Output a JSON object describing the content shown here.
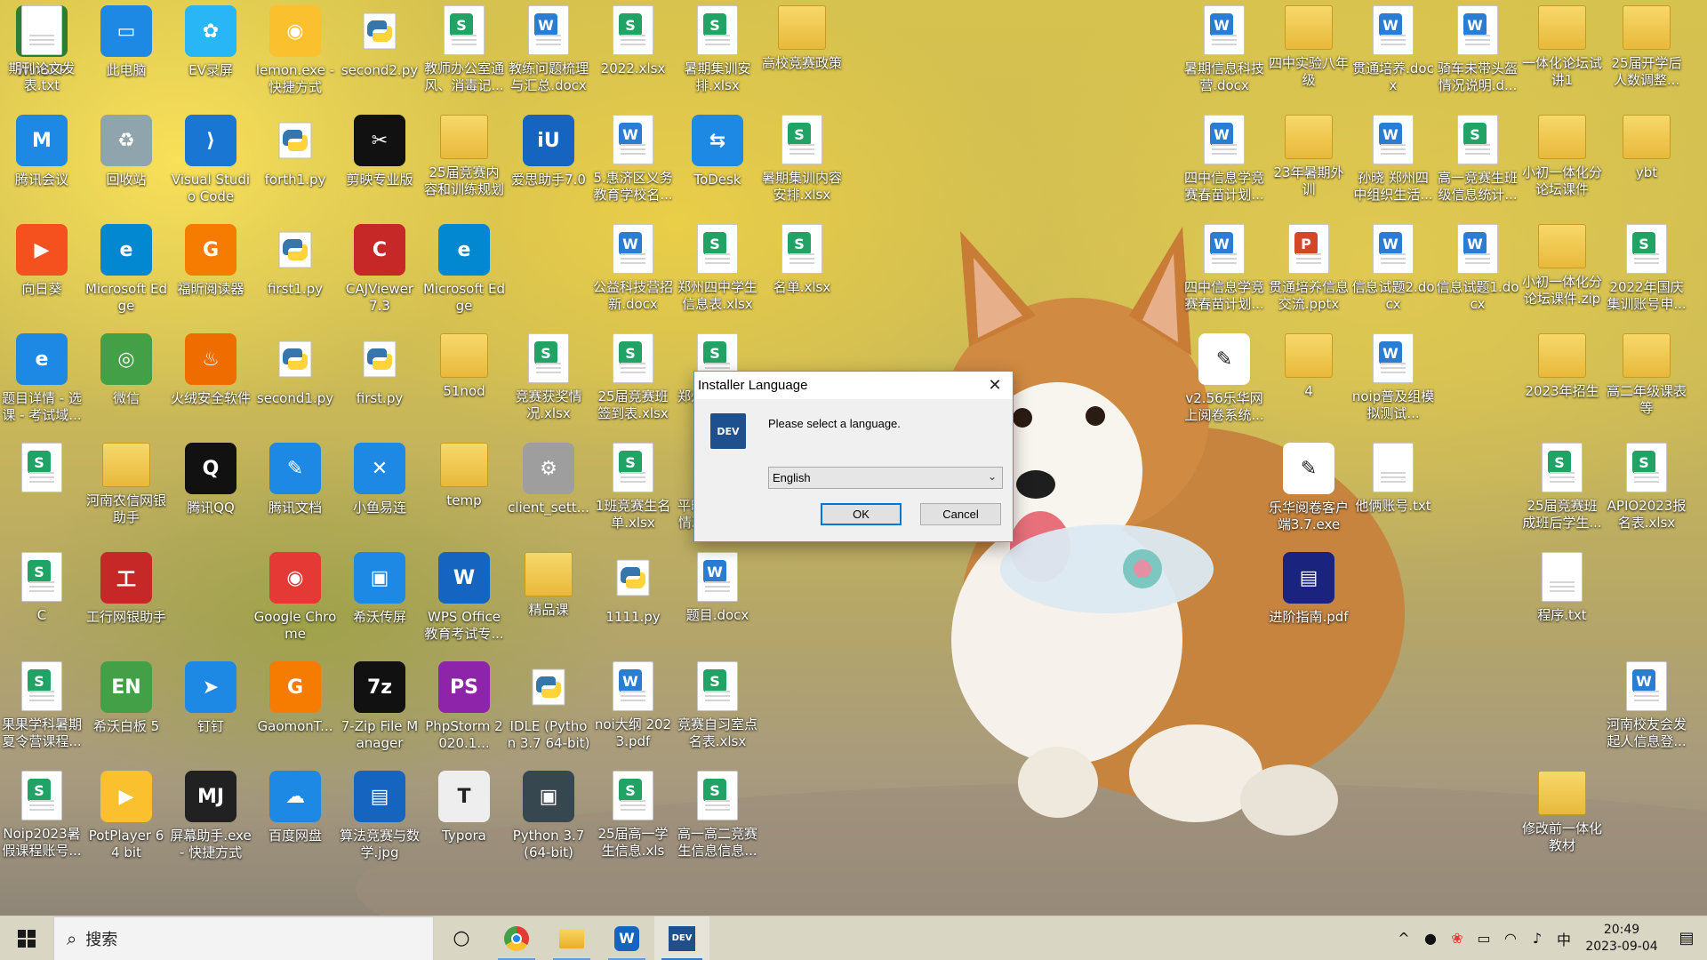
{
  "desktop_icons": [
    {
      "label": "WinSCP",
      "kind": "app",
      "color": "#2e7d32",
      "glyph": "⇄"
    },
    {
      "label": "此电脑",
      "kind": "app",
      "color": "#1e88e5",
      "glyph": "▭"
    },
    {
      "label": "EV录屏",
      "kind": "app",
      "color": "#29b6f6",
      "glyph": "✿"
    },
    {
      "label": "lemon.exe - 快捷方式",
      "kind": "app",
      "color": "#fbc02d",
      "glyph": "◉"
    },
    {
      "label": "second2.py",
      "kind": "py"
    },
    {
      "label": "教师办公室通风、消毒记...",
      "kind": "xlsx"
    },
    {
      "label": "教练问题梳理与汇总.docx",
      "kind": "docx"
    },
    {
      "label": "2022.xlsx",
      "kind": "xlsx"
    },
    {
      "label": "暑期集训安排.xlsx",
      "kind": "xlsx"
    },
    {
      "label": "高校竞赛政策",
      "kind": "folder"
    },
    {
      "label": "腾讯会议",
      "kind": "app",
      "color": "#1e88e5",
      "glyph": "M"
    },
    {
      "label": "回收站",
      "kind": "app",
      "color": "#90a4ae",
      "glyph": "♻"
    },
    {
      "label": "Visual Studio Code",
      "kind": "app",
      "color": "#1976d2",
      "glyph": "⟩"
    },
    {
      "label": "forth1.py",
      "kind": "py"
    },
    {
      "label": "剪映专业版",
      "kind": "app",
      "color": "#111111",
      "glyph": "✂"
    },
    {
      "label": "25届竞赛内容和训练规划",
      "kind": "folder"
    },
    {
      "label": "爱思助手7.0",
      "kind": "app",
      "color": "#1565c0",
      "glyph": "iU"
    },
    {
      "label": "5.惠济区义务教育学校名...",
      "kind": "docx"
    },
    {
      "label": "ToDesk",
      "kind": "app",
      "color": "#1e88e5",
      "glyph": "⇆"
    },
    {
      "label": "暑期集训内容安排.xlsx",
      "kind": "xlsx"
    },
    {
      "label": "向日葵",
      "kind": "app",
      "color": "#f4511e",
      "glyph": "▶"
    },
    {
      "label": "Microsoft Edge",
      "kind": "app",
      "color": "#0288d1",
      "glyph": "e"
    },
    {
      "label": "福昕阅读器",
      "kind": "app",
      "color": "#f57c00",
      "glyph": "G"
    },
    {
      "label": "first1.py",
      "kind": "py"
    },
    {
      "label": "CAJViewer 7.3",
      "kind": "app",
      "color": "#c62828",
      "glyph": "C"
    },
    {
      "label": "Microsoft Edge",
      "kind": "app",
      "color": "#0288d1",
      "glyph": "e"
    },
    {
      "label": "公益科技营招新.docx",
      "kind": "docx"
    },
    {
      "label": "郑州四中学生信息表.xlsx",
      "kind": "xlsx"
    },
    {
      "label": "名单.xlsx",
      "kind": "xlsx"
    },
    {
      "label": "题目详情 - 选课 - 考试域...",
      "kind": "app",
      "color": "#1e88e5",
      "glyph": "e"
    },
    {
      "label": "微信",
      "kind": "app",
      "color": "#43a047",
      "glyph": "◎"
    },
    {
      "label": "火绒安全软件",
      "kind": "app",
      "color": "#ef6c00",
      "glyph": "♨"
    },
    {
      "label": "second1.py",
      "kind": "py"
    },
    {
      "label": "first.py",
      "kind": "py"
    },
    {
      "label": "51nod",
      "kind": "folder"
    },
    {
      "label": "竞赛获奖情况.xlsx",
      "kind": "xlsx"
    },
    {
      "label": "25届竞赛班签到表.xlsx",
      "kind": "xlsx"
    },
    {
      "label": "郑州四中学生信息表",
      "kind": "xlsx"
    },
    {
      "label": "",
      "kind": "xlsx"
    },
    {
      "label": "河南农信网银助手",
      "kind": "folder"
    },
    {
      "label": "腾讯QQ",
      "kind": "app",
      "color": "#111111",
      "glyph": "Q"
    },
    {
      "label": "腾讯文档",
      "kind": "app",
      "color": "#1e88e5",
      "glyph": "✎"
    },
    {
      "label": "小鱼易连",
      "kind": "app",
      "color": "#1e88e5",
      "glyph": "✕"
    },
    {
      "label": "temp",
      "kind": "folder"
    },
    {
      "label": "client_sett...",
      "kind": "app",
      "color": "#9e9e9e",
      "glyph": "⚙"
    },
    {
      "label": "1班竞赛生名单.xlsx",
      "kind": "xlsx"
    },
    {
      "label": "平时考核分组情况（202...",
      "kind": "xlsx"
    },
    {
      "label": "C",
      "kind": "xlsx"
    },
    {
      "label": "工行网银助手",
      "kind": "app",
      "color": "#c62828",
      "glyph": "工"
    },
    {
      "label": "Google Chrome",
      "kind": "app",
      "color": "#e53935",
      "glyph": "◉"
    },
    {
      "label": "希沃传屏",
      "kind": "app",
      "color": "#1e88e5",
      "glyph": "▣"
    },
    {
      "label": "WPS Office 教育考试专...",
      "kind": "app",
      "color": "#1565c0",
      "glyph": "W"
    },
    {
      "label": "精品课",
      "kind": "folder"
    },
    {
      "label": "1111.py",
      "kind": "py"
    },
    {
      "label": "题目.docx",
      "kind": "docx"
    },
    {
      "label": "果果学科暑期夏令营课程...",
      "kind": "xlsx"
    },
    {
      "label": "希沃白板 5",
      "kind": "app",
      "color": "#43a047",
      "glyph": "EN"
    },
    {
      "label": "钉钉",
      "kind": "app",
      "color": "#1e88e5",
      "glyph": "➤"
    },
    {
      "label": "GaomonT...",
      "kind": "app",
      "color": "#f57c00",
      "glyph": "G"
    },
    {
      "label": "7-Zip File Manager",
      "kind": "app",
      "color": "#111111",
      "glyph": "7z"
    },
    {
      "label": "PhpStorm 2020.1...",
      "kind": "app",
      "color": "#8e24aa",
      "glyph": "PS"
    },
    {
      "label": "IDLE (Python 3.7 64-bit)",
      "kind": "py"
    },
    {
      "label": "noi大纲 2023.pdf",
      "kind": "docx"
    },
    {
      "label": "竞赛自习室点名表.xlsx",
      "kind": "xlsx"
    },
    {
      "label": "Noip2023暑假课程账号...",
      "kind": "xlsx"
    },
    {
      "label": "PotPlayer 64 bit",
      "kind": "app",
      "color": "#fbc02d",
      "glyph": "▶"
    },
    {
      "label": "屏幕助手.exe - 快捷方式",
      "kind": "app",
      "color": "#212121",
      "glyph": "MJ"
    },
    {
      "label": "百度网盘",
      "kind": "app",
      "color": "#1e88e5",
      "glyph": "☁"
    },
    {
      "label": "算法竞赛与数学.jpg",
      "kind": "app",
      "color": "#1565c0",
      "glyph": "▤"
    },
    {
      "label": "Typora",
      "kind": "app",
      "color": "#eeeeee",
      "glyph": "T"
    },
    {
      "label": "Python 3.7 (64-bit)",
      "kind": "app",
      "color": "#37474f",
      "glyph": "▣"
    },
    {
      "label": "25届高一学生信息.xls",
      "kind": "xlsx"
    },
    {
      "label": "高一高二竞赛生信息信息...",
      "kind": "xlsx"
    },
    {
      "label": "暑期信息科技营.docx",
      "kind": "docx"
    },
    {
      "label": "四中实验八年级",
      "kind": "folder"
    },
    {
      "label": "贯通培养.docx",
      "kind": "docx"
    },
    {
      "label": "骑车未带头盔情况说明.d...",
      "kind": "docx"
    },
    {
      "label": "一体化论坛试讲1",
      "kind": "folder"
    },
    {
      "label": "25届开学后人数调整...",
      "kind": "folder"
    },
    {
      "label": "四中信息学竞赛春苗计划...",
      "kind": "docx"
    },
    {
      "label": "23年暑期外训",
      "kind": "folder"
    },
    {
      "label": "孙晓 郑州四中组织生活...",
      "kind": "docx"
    },
    {
      "label": "高一竞赛生班级信息统计...",
      "kind": "xlsx"
    },
    {
      "label": "小初一体化分论坛课件",
      "kind": "folder"
    },
    {
      "label": "ybt",
      "kind": "folder"
    },
    {
      "label": "四中信息学竞赛春苗计划...",
      "kind": "docx"
    },
    {
      "label": "贯通培养信息交流.pptx",
      "kind": "pptx"
    },
    {
      "label": "信息试题2.docx",
      "kind": "docx"
    },
    {
      "label": "信息试题1.docx",
      "kind": "docx"
    },
    {
      "label": "小初一体化分论坛课件.zip",
      "kind": "folder"
    },
    {
      "label": "2022年国庆集训账号申...",
      "kind": "xlsx"
    },
    {
      "label": "v2.56乐华网上阅卷系统...",
      "kind": "app",
      "color": "#ffffff",
      "glyph": "✎"
    },
    {
      "label": "4",
      "kind": "folder"
    },
    {
      "label": "noip普及组模拟测试...",
      "kind": "docx"
    },
    {
      "label": "2023年招生",
      "kind": "folder"
    },
    {
      "label": "高二年级课表等",
      "kind": "folder"
    },
    {
      "label": "乐华阅卷客户端3.7.exe",
      "kind": "app",
      "color": "#ffffff",
      "glyph": "✎"
    },
    {
      "label": "他俩账号.txt",
      "kind": "txt"
    },
    {
      "label": "25届竞赛班成班后学生...",
      "kind": "xlsx"
    },
    {
      "label": "APIO2023报名表.xlsx",
      "kind": "xlsx"
    },
    {
      "label": "进阶指南.pdf",
      "kind": "app",
      "color": "#1a237e",
      "glyph": "▤"
    },
    {
      "label": "程序.txt",
      "kind": "txt"
    },
    {
      "label": "河南校友会发起人信息登...",
      "kind": "docx"
    },
    {
      "label": "修改前一体化教材",
      "kind": "folder"
    },
    {
      "label": "期刊论文发表.txt",
      "kind": "txt"
    }
  ],
  "dialog": {
    "title": "Installer Language",
    "close_symbol": "✕",
    "logo_text": "DEV",
    "prompt": "Please select a language.",
    "selected_language": "English",
    "ok_label": "OK",
    "cancel_label": "Cancel"
  },
  "taskbar": {
    "search_placeholder": "搜索",
    "pinned": [
      {
        "name": "cortana-icon",
        "glyph": "○",
        "color": "#111111"
      },
      {
        "name": "chrome-icon",
        "glyph": "◉",
        "color": "#e53935"
      },
      {
        "name": "file-explorer-icon",
        "glyph": "▬",
        "color": "#f9a825"
      },
      {
        "name": "wps-icon",
        "glyph": "W",
        "color": "#1565c0"
      },
      {
        "name": "devcpp-icon",
        "glyph": "DEV",
        "color": "#1f4f8c"
      }
    ],
    "tray": {
      "chevron": "^",
      "mic": "🎙",
      "app": "❀",
      "battery": "▭",
      "wifi": "◠",
      "volume": "♪",
      "ime": "中"
    },
    "time": "20:49",
    "date": "2023-09-04",
    "notification_symbol": "▤"
  },
  "colors": {
    "xlsx": "#21a366",
    "docx": "#2b7cd3",
    "pptx": "#d24726",
    "accent": "#0078d7"
  }
}
